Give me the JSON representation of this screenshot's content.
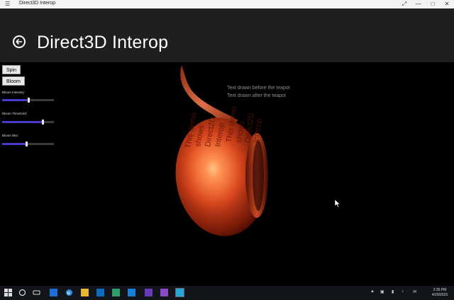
{
  "window": {
    "title": "Direct3D Interop"
  },
  "header": {
    "title": "Direct3D Interop"
  },
  "controls": {
    "spin_label": "Spin",
    "bloom_label": "Bloom",
    "sliders": [
      {
        "label": "Bloom Intensity:",
        "value": 0.52
      },
      {
        "label": "Bloom Threshold:",
        "value": 0.79
      },
      {
        "label": "Bloom Blur:",
        "value": 0.47
      }
    ]
  },
  "overlay": {
    "line1": "Text drawn before the teapot",
    "line2": "Text drawn after the teapot"
  },
  "teapot_text": [
    "This demo",
    "shows",
    "Direct2D",
    "Interop",
    "This demo",
    "shows",
    "Direct2D",
    "Interop"
  ],
  "taskbar": {
    "clock_time": "2:35 PM",
    "clock_date": "4/29/2015"
  },
  "colors": {
    "header_bg": "#1f1f1f",
    "slider_fill": "#4a3acb",
    "teapot": "#d2431c"
  }
}
